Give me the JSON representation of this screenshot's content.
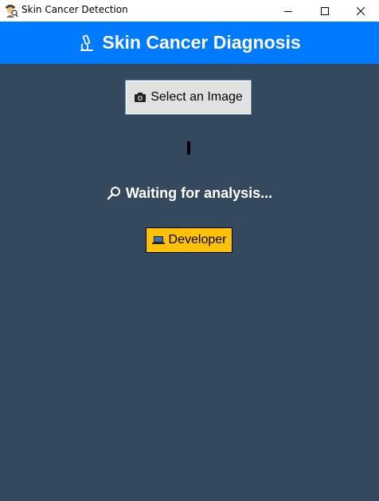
{
  "window": {
    "title": "Skin Cancer Detection",
    "app_icon": "detective-icon",
    "controls": {
      "minimize": "minimize-icon",
      "maximize": "maximize-icon",
      "close": "close-icon"
    }
  },
  "header": {
    "icon": "microscope-icon",
    "title": "Skin Cancer Diagnosis"
  },
  "select_button": {
    "icon": "camera-icon",
    "label": "Select an Image"
  },
  "status": {
    "icon": "magnifier-icon",
    "text": "Waiting for analysis..."
  },
  "developer_button": {
    "icon": "laptop-icon",
    "label": "Developer"
  },
  "colors": {
    "background": "#34495e",
    "header": "#007bff",
    "developer_button": "#ffc107",
    "select_button": "#e1e1e1"
  }
}
